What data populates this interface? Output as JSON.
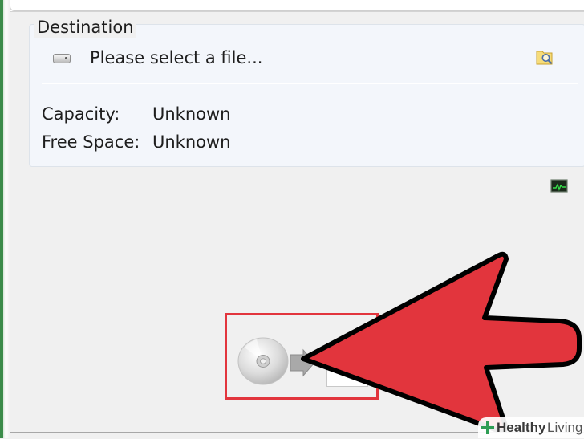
{
  "destination": {
    "legend": "Destination",
    "file_placeholder": "Please select a file...",
    "capacity_label": "Capacity:",
    "capacity_value": "Unknown",
    "free_space_label": "Free Space:",
    "free_space_value": "Unknown"
  },
  "icons": {
    "drive": "drive-icon",
    "browse": "browse-folder-icon",
    "monitor": "monitor-icon",
    "disc": "disc-icon",
    "write_arrow": "arrow-right-icon"
  },
  "annotation": {
    "highlight_color": "#e2353d",
    "arrow_color": "#e2353d"
  },
  "watermark": {
    "brand_bold": "Healthy",
    "brand_light": "Living"
  }
}
